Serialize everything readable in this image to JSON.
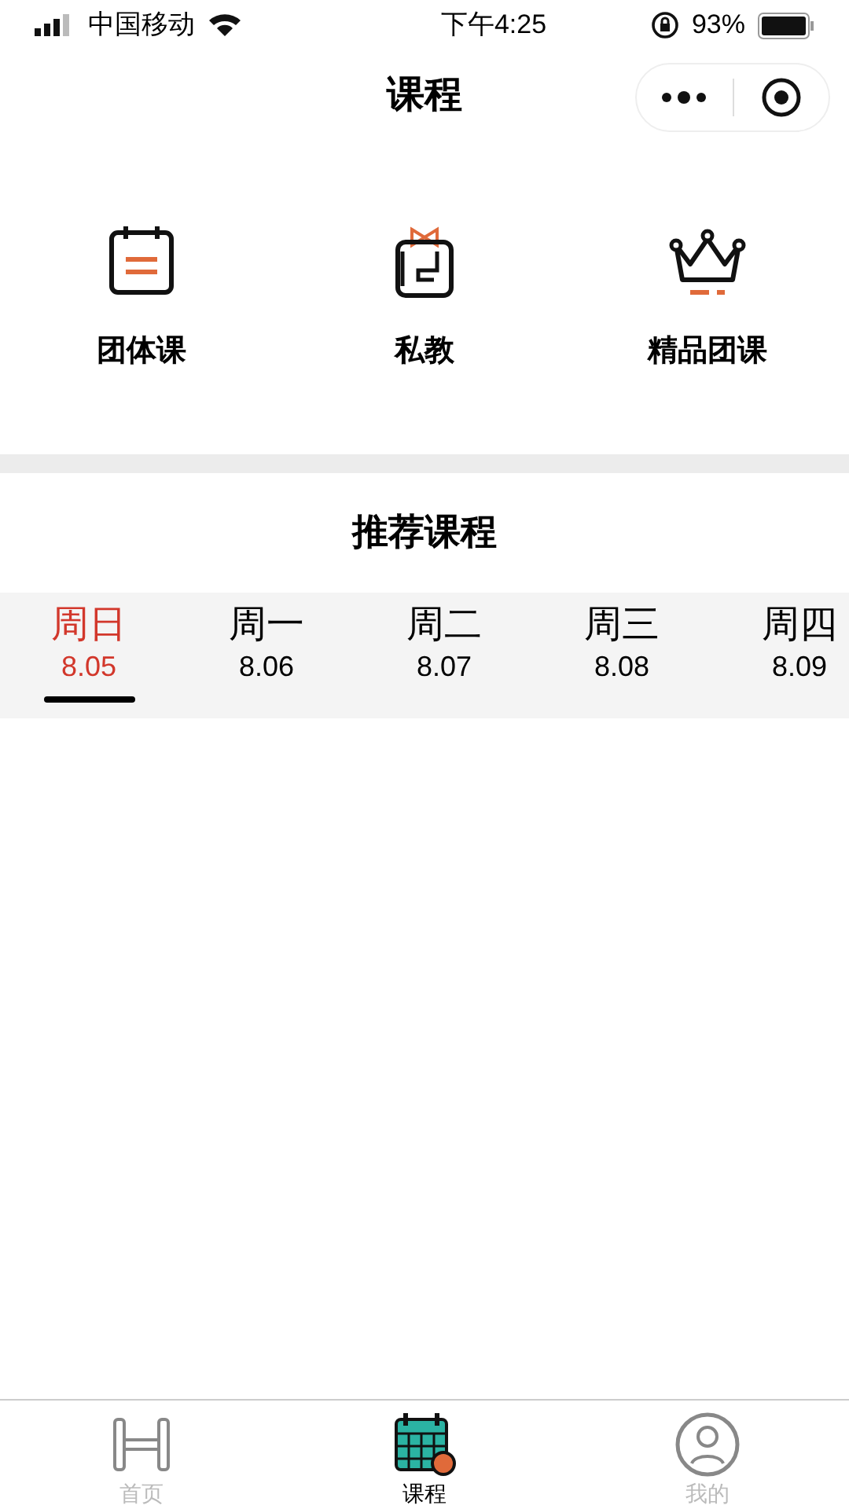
{
  "status_bar": {
    "carrier": "中国移动",
    "time": "下午4:25",
    "battery": "93%"
  },
  "nav": {
    "title": "课程"
  },
  "categories": [
    {
      "kind": "calendar",
      "label": "团体课"
    },
    {
      "kind": "gift",
      "label": "私教"
    },
    {
      "kind": "crown",
      "label": "精品团课"
    }
  ],
  "section": {
    "title": "推荐课程"
  },
  "days": [
    {
      "day": "周日",
      "date": "8.05",
      "selected": true
    },
    {
      "day": "周一",
      "date": "8.06",
      "selected": false
    },
    {
      "day": "周二",
      "date": "8.07",
      "selected": false
    },
    {
      "day": "周三",
      "date": "8.08",
      "selected": false
    },
    {
      "day": "周四",
      "date": "8.09",
      "selected": false
    }
  ],
  "tab_bar": [
    {
      "kind": "dumbbell",
      "label": "首页",
      "selected": false
    },
    {
      "kind": "calendar",
      "label": "课程",
      "selected": true
    },
    {
      "kind": "person",
      "label": "我的",
      "selected": false
    }
  ]
}
